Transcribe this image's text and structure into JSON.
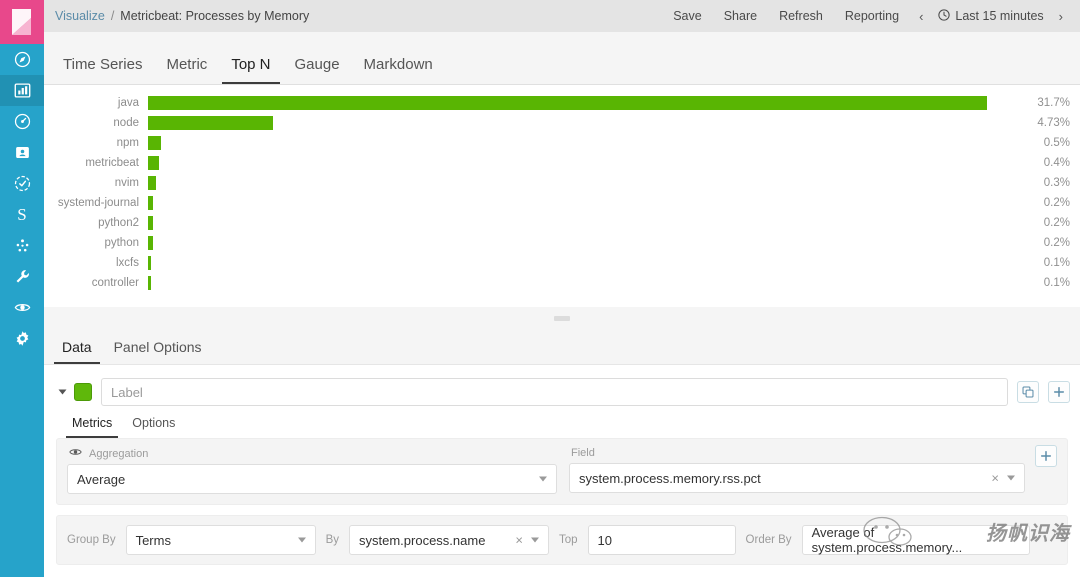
{
  "sidebar": {
    "logo": "kibana-logo",
    "items": [
      {
        "name": "discover",
        "icon": "compass-icon",
        "active": false
      },
      {
        "name": "visualize",
        "icon": "bar-chart-icon",
        "active": true
      },
      {
        "name": "dashboard",
        "icon": "dashboard-icon",
        "active": false
      },
      {
        "name": "timelion",
        "icon": "timelion-icon",
        "active": false
      },
      {
        "name": "apm",
        "icon": "apm-icon",
        "active": false
      },
      {
        "name": "siem",
        "icon": "letter-s-icon",
        "letter": "S",
        "active": false
      },
      {
        "name": "graph",
        "icon": "graph-icon",
        "active": false
      },
      {
        "name": "dev-tools",
        "icon": "wrench-icon",
        "active": false
      },
      {
        "name": "monitoring",
        "icon": "eye-icon",
        "active": false
      },
      {
        "name": "management",
        "icon": "gear-icon",
        "active": false
      }
    ]
  },
  "header": {
    "breadcrumb_parent": "Visualize",
    "breadcrumb_separator": "/",
    "breadcrumb_current": "Metricbeat: Processes by Memory",
    "actions": [
      "Save",
      "Share",
      "Refresh",
      "Reporting"
    ],
    "prev_arrow": "‹",
    "next_arrow": "›",
    "clock_icon": "clock-icon",
    "time_range": "Last 15 minutes"
  },
  "vis_tabs": [
    {
      "label": "Time Series",
      "active": false
    },
    {
      "label": "Metric",
      "active": false
    },
    {
      "label": "Top N",
      "active": true
    },
    {
      "label": "Gauge",
      "active": false
    },
    {
      "label": "Markdown",
      "active": false
    }
  ],
  "chart_data": {
    "type": "bar",
    "orientation": "horizontal",
    "title": "Metricbeat: Processes by Memory",
    "xlabel": "",
    "ylabel": "",
    "categories": [
      "java",
      "node",
      "npm",
      "metricbeat",
      "nvim",
      "systemd-journal",
      "python2",
      "python",
      "lxcfs",
      "controller"
    ],
    "values": [
      31.7,
      4.73,
      0.5,
      0.4,
      0.3,
      0.2,
      0.2,
      0.2,
      0.1,
      0.1
    ],
    "value_labels": [
      "31.7%",
      "4.73%",
      "0.5%",
      "0.4%",
      "0.3%",
      "0.2%",
      "0.2%",
      "0.2%",
      "0.1%",
      "0.1%"
    ],
    "bar_color": "#59b503",
    "xlim": [
      0,
      32.5
    ],
    "grid": false,
    "legend": "none"
  },
  "splitter": {
    "grip": "resize-grip"
  },
  "editor_tabs": [
    {
      "label": "Data",
      "active": true
    },
    {
      "label": "Panel Options",
      "active": false
    }
  ],
  "series": {
    "caret": "collapse-caret",
    "color": "#5fb80b",
    "label_value": "",
    "label_placeholder": "Label",
    "clone_button": "clone-series",
    "add_button": "add-series",
    "inner_tabs": [
      {
        "label": "Metrics",
        "active": true
      },
      {
        "label": "Options",
        "active": false
      }
    ],
    "aggregation_label": "Aggregation",
    "aggregation_value": "Average",
    "field_label": "Field",
    "field_value": "system.process.memory.rss.pct",
    "add_metric_button": "add-metric",
    "group_by_label": "Group By",
    "group_by_value": "Terms",
    "by_label": "By",
    "by_value": "system.process.name",
    "top_label": "Top",
    "top_value": "10",
    "order_by_label": "Order By",
    "order_by_value": "Average of system.process.memory..."
  },
  "watermark": {
    "text": "扬帆识海"
  },
  "colors": {
    "sidebar": "#26a3ca",
    "logo": "#e8488b",
    "header": "#e4e4e4",
    "accent_green": "#59b503",
    "link": "#5a8ba8"
  }
}
